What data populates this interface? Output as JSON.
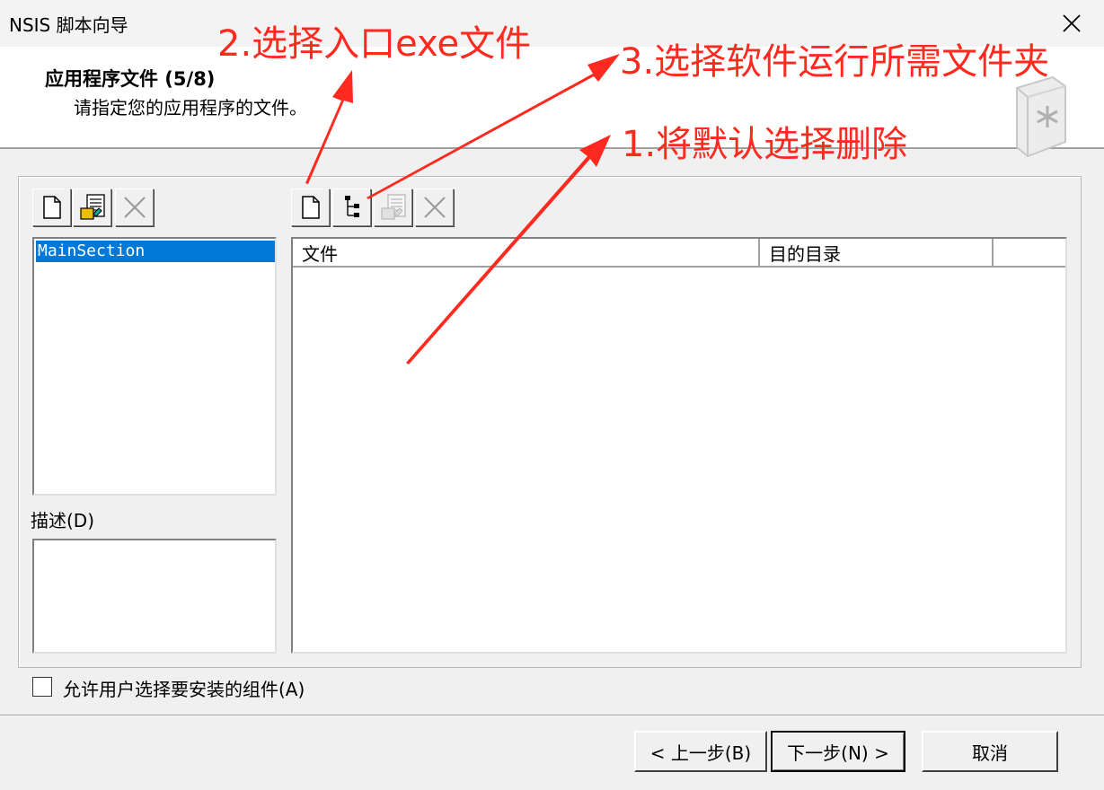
{
  "window": {
    "title": "NSIS 脚本向导",
    "close_glyph": "✕"
  },
  "header": {
    "title": "应用程序文件 (5/8)",
    "subtitle": "请指定您的应用程序的文件。"
  },
  "sections": {
    "items": [
      {
        "label": "MainSection",
        "selected": true
      }
    ]
  },
  "description": {
    "label": "描述(D)"
  },
  "files": {
    "columns": [
      "文件",
      "目的目录"
    ]
  },
  "allow_select": {
    "label": "允许用户选择要安装的组件(A)",
    "checked": false
  },
  "buttons": {
    "back": "< 上一步(B)",
    "next": "下一步(N) >",
    "cancel": "取消"
  },
  "annotations": {
    "step1": "1.将默认选择删除",
    "step2": "2.选择入口exe文件",
    "step3": "3.选择软件运行所需文件夹",
    "color": "#ff2a1f"
  },
  "icons": {
    "section_add": "new-file-icon",
    "section_edit": "edit-icon",
    "section_delete": "delete-icon",
    "file_add": "new-file-icon",
    "folder_add": "folder-tree-icon",
    "file_edit": "edit-icon",
    "file_delete": "delete-icon"
  },
  "colors": {
    "selection": "#0078d7",
    "window_bg": "#f0f0f0"
  }
}
